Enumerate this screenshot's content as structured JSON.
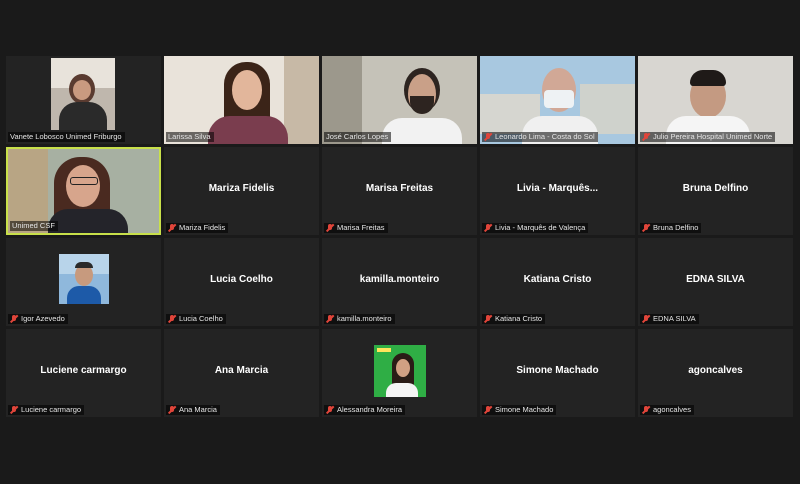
{
  "meeting": {
    "participants": [
      {
        "id": "p1",
        "label": "Vanete Lobosco Unimed Friburgo",
        "display": "",
        "muted": false
      },
      {
        "id": "p2",
        "label": "Larissa Silva",
        "display": "",
        "muted": false
      },
      {
        "id": "p3",
        "label": "José Carlos Lopes",
        "display": "",
        "muted": false
      },
      {
        "id": "p4",
        "label": "Leonardo Lima - Costa do Sol",
        "display": "",
        "muted": true
      },
      {
        "id": "p5",
        "label": "Julio Pereira Hospital Unimed Norte",
        "display": "",
        "muted": true
      },
      {
        "id": "p6",
        "label": "Unimed CSF",
        "display": "",
        "muted": false,
        "active": true
      },
      {
        "id": "p7",
        "label": "Mariza Fidelis",
        "display": "Mariza Fidelis",
        "muted": true
      },
      {
        "id": "p8",
        "label": "Marisa Freitas",
        "display": "Marisa Freitas",
        "muted": true
      },
      {
        "id": "p9",
        "label": "Livia - Marquês de Valença",
        "display": "Livia - Marquês...",
        "muted": true
      },
      {
        "id": "p10",
        "label": "Bruna Delfino",
        "display": "Bruna Delfino",
        "muted": true
      },
      {
        "id": "p11",
        "label": "Igor Azevedo",
        "display": "",
        "muted": true
      },
      {
        "id": "p12",
        "label": "Lucia Coelho",
        "display": "Lucia Coelho",
        "muted": true
      },
      {
        "id": "p13",
        "label": "kamilla.monteiro",
        "display": "kamilla.monteiro",
        "muted": true
      },
      {
        "id": "p14",
        "label": "Katiana Cristo",
        "display": "Katiana Cristo",
        "muted": true
      },
      {
        "id": "p15",
        "label": "EDNA SILVA",
        "display": "EDNA SILVA",
        "muted": true
      },
      {
        "id": "p16",
        "label": "Luciene carmargo",
        "display": "Luciene carmargo",
        "muted": true
      },
      {
        "id": "p17",
        "label": "Ana Marcia",
        "display": "Ana Marcia",
        "muted": true
      },
      {
        "id": "p18",
        "label": "Alessandra Moreira",
        "display": "",
        "muted": true
      },
      {
        "id": "p19",
        "label": "Simone Machado",
        "display": "Simone Machado",
        "muted": true
      },
      {
        "id": "p20",
        "label": "agoncalves",
        "display": "agoncalves",
        "muted": true
      }
    ]
  },
  "colors": {
    "active_border": "#c8e04a",
    "muted_icon": "#e0453a",
    "tile_bg": "#232323",
    "page_bg": "#1a1a1a"
  }
}
